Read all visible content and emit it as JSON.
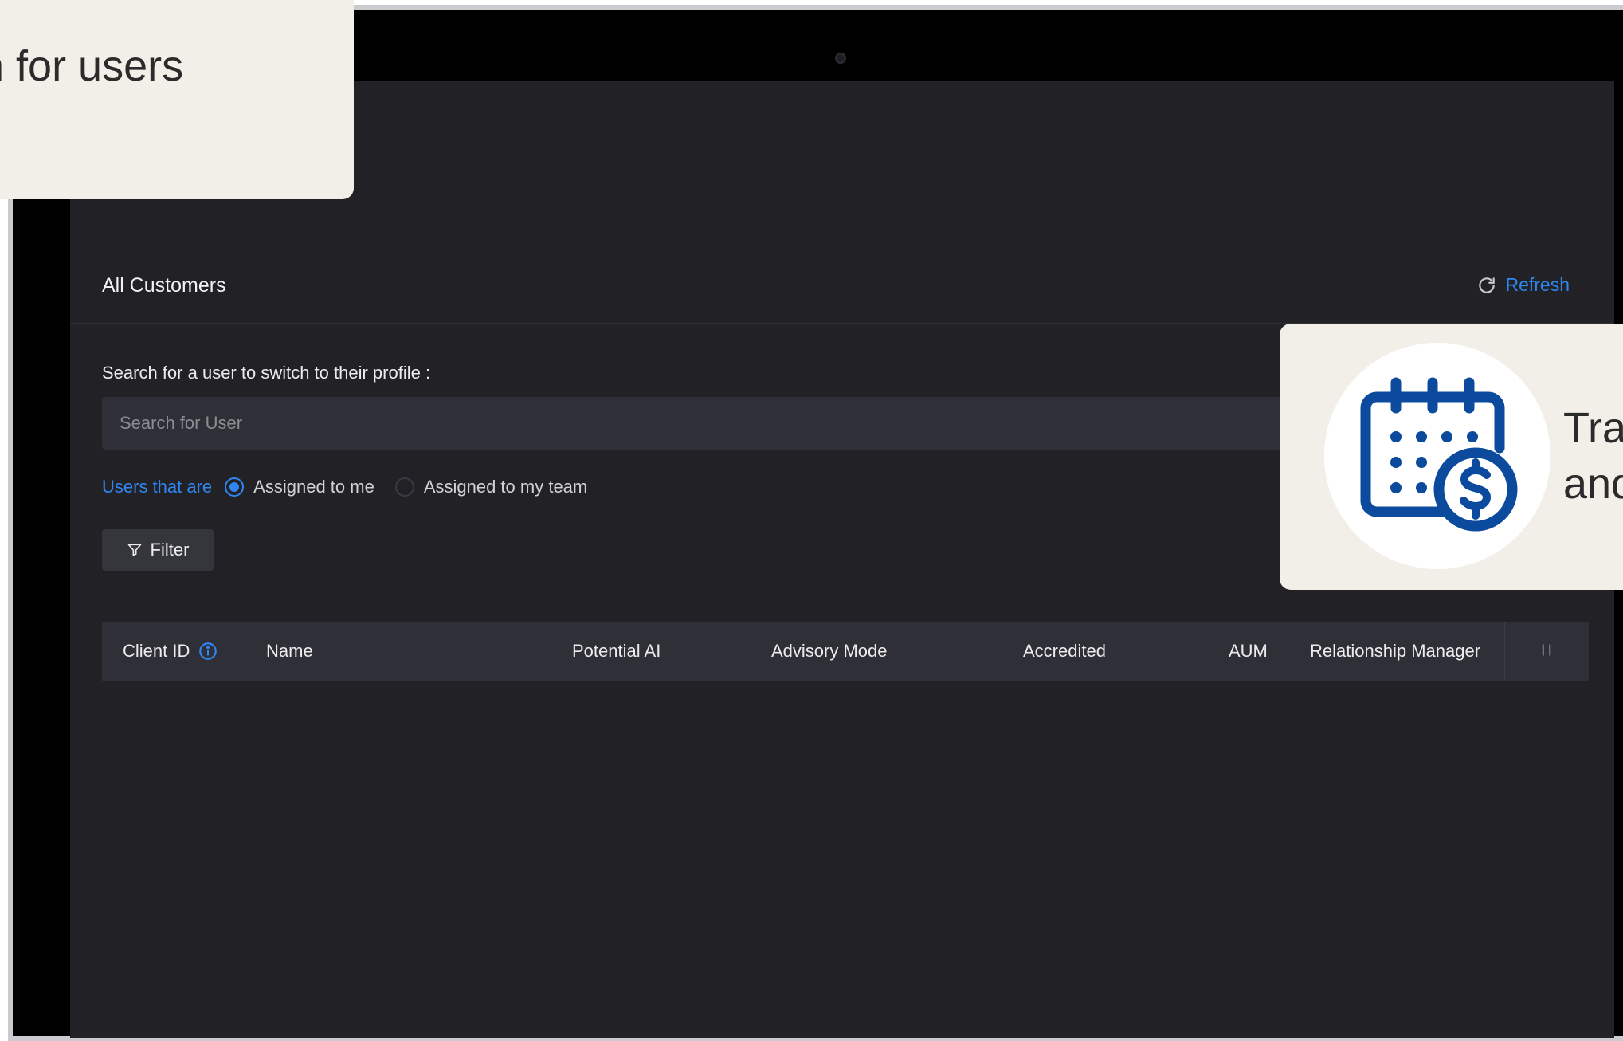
{
  "header": {
    "title": "All Customers",
    "refresh_label": "Refresh"
  },
  "search": {
    "label": "Search for a user to switch to their profile :",
    "placeholder": "Search for User",
    "value": ""
  },
  "assignment": {
    "prefix": "Users that are",
    "options": [
      {
        "label": "Assigned to me",
        "selected": true
      },
      {
        "label": "Assigned to my team",
        "selected": false
      }
    ]
  },
  "filter": {
    "label": "Filter"
  },
  "table": {
    "columns": [
      "Client ID",
      "Name",
      "Potential AI",
      "Advisory Mode",
      "Accredited",
      "AUM",
      "Relationship Manager"
    ],
    "handle": "II"
  },
  "callouts": {
    "left_text": "ch for users",
    "right_line1": "Tra",
    "right_line2": "and"
  },
  "colors": {
    "accent": "#2f86f0",
    "screen_bg": "#222226",
    "input_bg": "#2f2f37",
    "callout_bg": "#f1efe8",
    "icon_blue": "#0b4a9c"
  },
  "icons": {
    "refresh": "refresh-icon",
    "filter": "funnel-icon",
    "info": "info-icon",
    "calendar": "calendar-dollar-icon"
  }
}
